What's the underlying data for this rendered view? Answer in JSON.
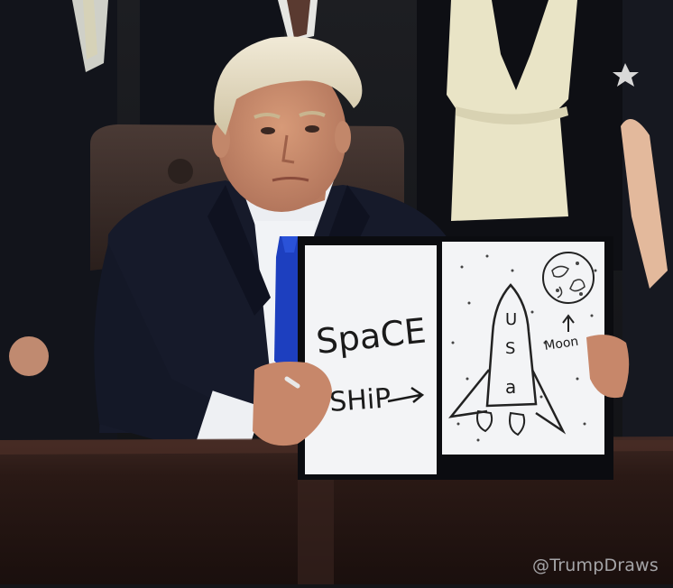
{
  "photo": {
    "description_tag": "photo",
    "drawing": {
      "left_page_text_1": "SpaCE",
      "left_page_text_2": "SHiP",
      "rocket_letters_1": "U",
      "rocket_letters_2": "S",
      "rocket_letters_3": "a",
      "moon_label": "Moon"
    },
    "watermark": "@TrumpDraws"
  },
  "colors": {
    "background": "#141518",
    "suit": "#161a2a",
    "tie": "#1d3fbf",
    "paper": "#f3f4f6",
    "desk": "#2a1a15"
  }
}
